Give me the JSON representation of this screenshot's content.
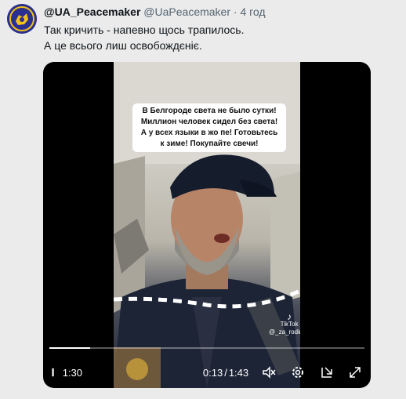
{
  "tweet": {
    "display_name": "@UA_Peacemaker",
    "handle": "@UaPeacemaker",
    "separator": "·",
    "time": "4 год",
    "text_lines": [
      "Так кричить - напевно щось трапилось.",
      "А це всього лиш освобождєніє."
    ]
  },
  "video": {
    "caption_lines": [
      "В Белгороде света не было сутки!",
      "Миллион человек сидел без света!",
      "А у всех языки в жо пе! Готовьтесь",
      "к зиме! Покупайте свечи!"
    ],
    "watermark_brand": "TikTok",
    "watermark_user": "@_za_rodinu_",
    "progress": 0.13,
    "left_time": "1:30",
    "current_time": "0:13",
    "duration": "1:43",
    "time_separator": "/"
  },
  "icons": {
    "play": "play-icon",
    "volume": "volume-muted-icon",
    "settings": "gear-icon",
    "pip": "picture-in-picture-icon",
    "fullscreen": "fullscreen-icon"
  },
  "colors": {
    "background": "#ebebeb",
    "text": "#0f1419",
    "secondary": "#536471"
  }
}
